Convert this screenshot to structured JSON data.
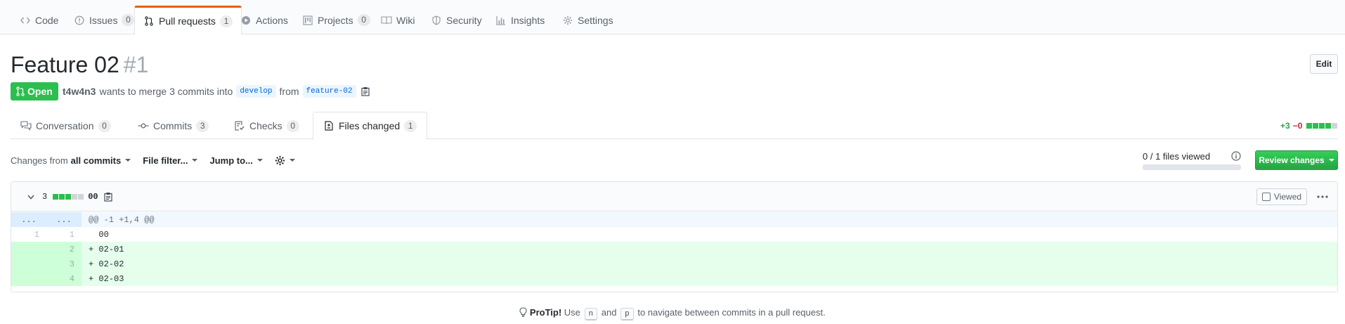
{
  "repo_nav": {
    "tabs": [
      {
        "label": "Code",
        "icon": "code-icon",
        "count": null
      },
      {
        "label": "Issues",
        "icon": "issue-icon",
        "count": "0"
      },
      {
        "label": "Pull requests",
        "icon": "pull-request-icon",
        "count": "1"
      },
      {
        "label": "Actions",
        "icon": "play-icon",
        "count": null
      },
      {
        "label": "Projects",
        "icon": "project-icon",
        "count": "0"
      },
      {
        "label": "Wiki",
        "icon": "book-icon",
        "count": null
      },
      {
        "label": "Security",
        "icon": "shield-icon",
        "count": null
      },
      {
        "label": "Insights",
        "icon": "graph-icon",
        "count": null
      },
      {
        "label": "Settings",
        "icon": "gear-icon",
        "count": null
      }
    ],
    "active": "Pull requests",
    "accent_color": "#e36209"
  },
  "pr": {
    "title": "Feature 02",
    "number": "#1",
    "edit_label": "Edit",
    "state": "Open",
    "state_color": "#2cbe4e",
    "author": "t4w4n3",
    "merge_text": "wants to merge 3 commits into",
    "base_branch": "develop",
    "from_text": "from",
    "head_branch": "feature-02"
  },
  "pr_tabs": {
    "conversation": {
      "label": "Conversation",
      "count": "0"
    },
    "commits": {
      "label": "Commits",
      "count": "3"
    },
    "checks": {
      "label": "Checks",
      "count": "0"
    },
    "files_changed": {
      "label": "Files changed",
      "count": "1"
    }
  },
  "diffstat": {
    "additions": "+3",
    "deletions": "−0"
  },
  "toolbar": {
    "changes_from_prefix": "Changes from",
    "changes_from_value": "all commits",
    "file_filter": "File filter...",
    "jump_to": "Jump to...",
    "files_viewed": "0 / 1 files viewed",
    "files_viewed_fraction": 0,
    "review_button": "Review changes"
  },
  "file": {
    "change_count": "3",
    "name": "00",
    "viewed_label": "Viewed",
    "hunk_header": "@@ -1 +1,4 @@",
    "hunk_expander": "...",
    "lines": [
      {
        "type": "context",
        "old": "1",
        "new": "1",
        "text": "  00"
      },
      {
        "type": "add",
        "old": "",
        "new": "2",
        "text": "+ 02-01"
      },
      {
        "type": "add",
        "old": "",
        "new": "3",
        "text": "+ 02-02"
      },
      {
        "type": "add",
        "old": "",
        "new": "4",
        "text": "+ 02-03"
      }
    ]
  },
  "protip": {
    "label": "ProTip!",
    "text_use": "Use",
    "key_n": "n",
    "text_and": "and",
    "key_p": "p",
    "text_rest": "to navigate between commits in a pull request."
  }
}
